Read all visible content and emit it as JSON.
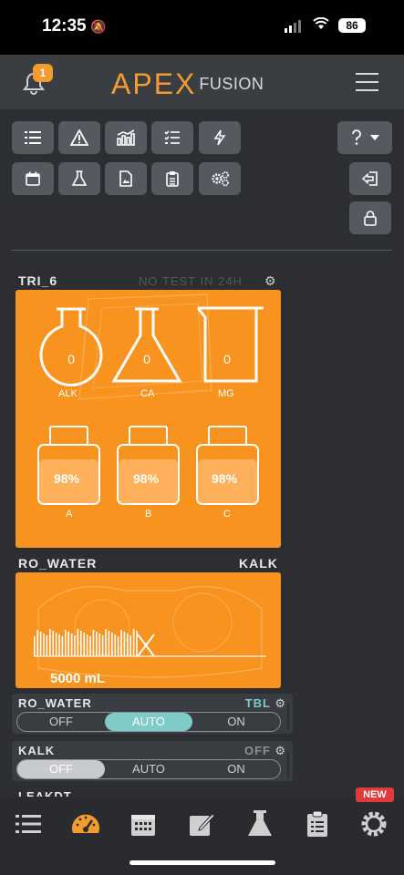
{
  "status_bar": {
    "time": "12:35",
    "battery": "86"
  },
  "header": {
    "notifications_count": "1",
    "logo_apex": "APEX",
    "logo_fusion": "FUSION"
  },
  "toolbar": {
    "row1": [
      "list-icon",
      "warning-icon",
      "chart-icon",
      "checklist-icon",
      "bolt-icon"
    ],
    "row2": [
      "calendar-icon",
      "flask-icon",
      "image-file-icon",
      "clipboard-icon",
      "gears-icon"
    ],
    "right": [
      "help-dropdown-icon",
      "logout-icon",
      "lock-icon"
    ]
  },
  "trident": {
    "name": "TRI_6",
    "status_text": "NO TEST IN 24H",
    "tests": [
      {
        "value": "0",
        "label": "ALK"
      },
      {
        "value": "0",
        "label": "CA"
      },
      {
        "value": "0",
        "label": "MG"
      }
    ],
    "reagents": [
      {
        "value": "98%",
        "label": "A"
      },
      {
        "value": "98%",
        "label": "B"
      },
      {
        "value": "98%",
        "label": "C"
      }
    ]
  },
  "dos": {
    "left_name": "RO_WATER",
    "right_name": "KALK",
    "volume": "5000 mL"
  },
  "controls": [
    {
      "name": "RO_WATER",
      "status": "TBL",
      "options": [
        "OFF",
        "AUTO",
        "ON"
      ],
      "selected": "AUTO"
    },
    {
      "name": "KALK",
      "status": "OFF",
      "options": [
        "OFF",
        "AUTO",
        "ON"
      ],
      "selected": "OFF"
    }
  ],
  "partial_next": "LEAKDT",
  "tabbar": {
    "items": [
      "list-icon",
      "dashboard-gauge-icon",
      "calendar-icon",
      "edit-icon",
      "flask-icon",
      "clipboard-icon",
      "settings-gear-icon"
    ],
    "new_badge": "NEW"
  },
  "colors": {
    "accent": "#f7931e",
    "auto_active": "#7ecbc8",
    "tbl_status": "#7ecbc8"
  }
}
